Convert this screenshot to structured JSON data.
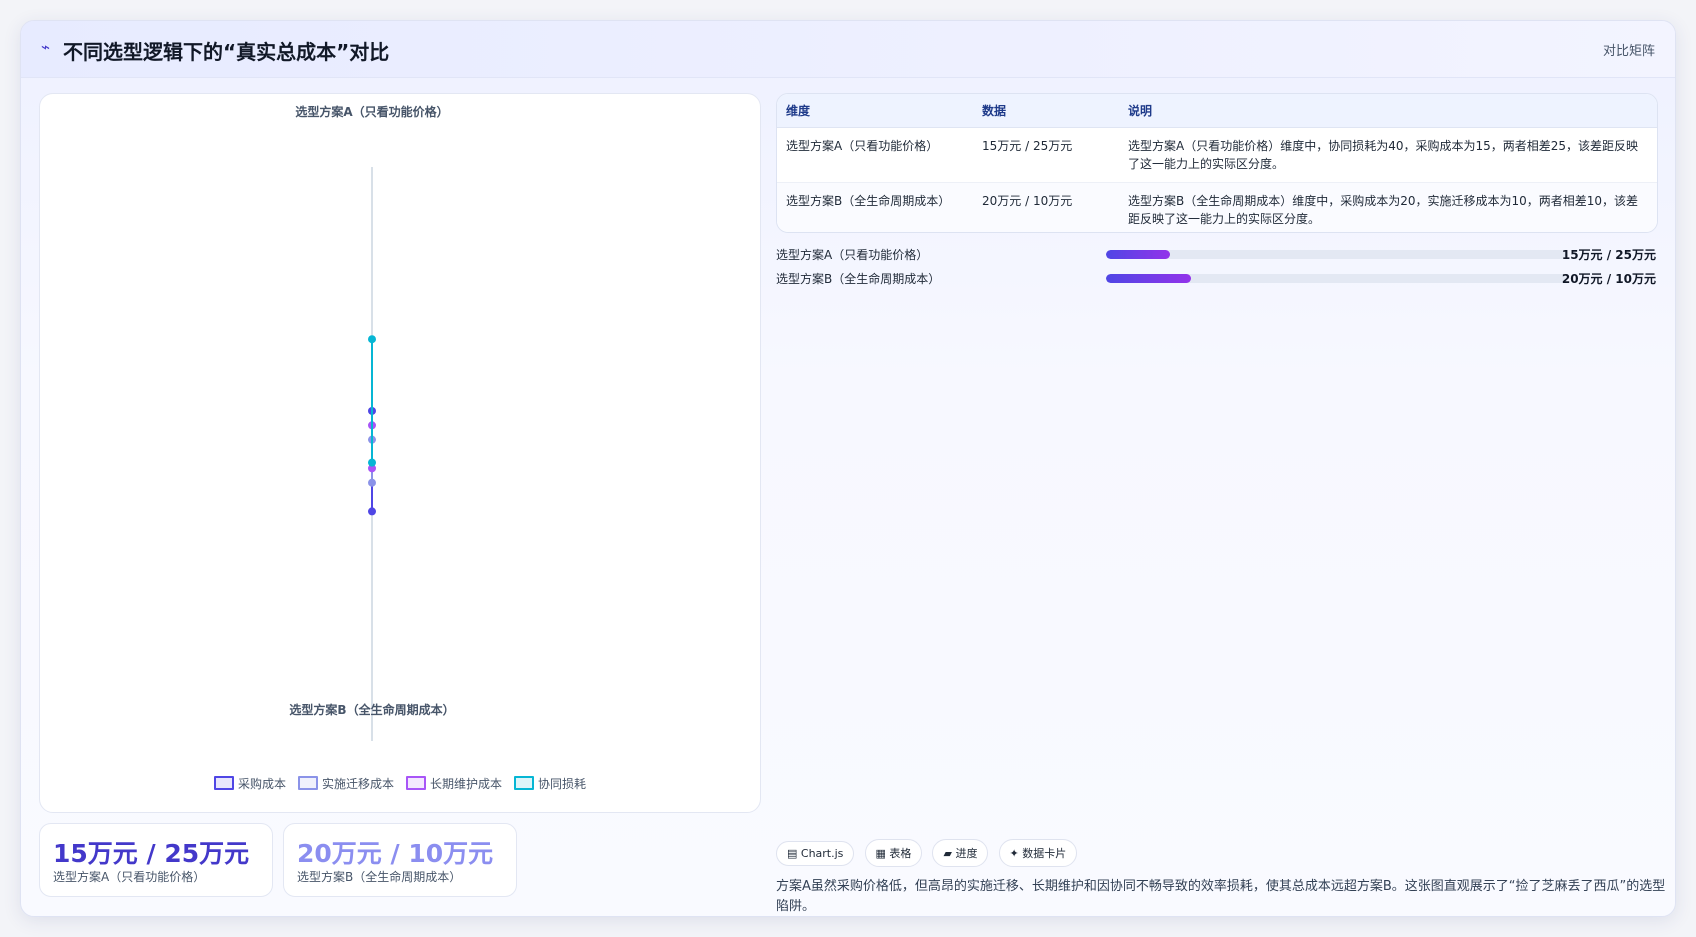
{
  "header": {
    "icon": "sparkline-icon",
    "title": "不同选型逻辑下的“真实总成本”对比",
    "right_label": "对比矩阵"
  },
  "chart_data": {
    "type": "radar",
    "categories": [
      "选型方案A（只看功能价格）",
      "选型方案B（全生命周期成本）"
    ],
    "series": [
      {
        "name": "采购成本",
        "values": [
          15,
          20
        ],
        "color": "#4f46e5"
      },
      {
        "name": "实施迁移成本",
        "values": [
          5,
          10
        ],
        "color": "#8b93e8"
      },
      {
        "name": "长期维护成本",
        "values": [
          10,
          5
        ],
        "color": "#a855f7"
      },
      {
        "name": "协同损耗",
        "values": [
          40,
          3
        ],
        "color": "#06b6d4"
      }
    ],
    "rmax": 100,
    "legend_position": "bottom"
  },
  "kpis": [
    {
      "value": "15万元 / 25万元",
      "label": "选型方案A（只看功能价格）",
      "color": "#4338ca"
    },
    {
      "value": "20万元 / 10万元",
      "label": "选型方案B（全生命周期成本）",
      "color": "#8b8ef0"
    }
  ],
  "table": {
    "headers": [
      "维度",
      "数据",
      "说明"
    ],
    "rows": [
      [
        "选型方案A（只看功能价格）",
        "15万元 / 25万元",
        "选型方案A（只看功能价格）维度中，协同损耗为40，采购成本为15，两者相差25，该差距反映了这一能力上的实际区分度。"
      ],
      [
        "选型方案B（全生命周期成本）",
        "20万元 / 10万元",
        "选型方案B（全生命周期成本）维度中，采购成本为20，实施迁移成本为10，两者相差10，该差距反映了这一能力上的实际区分度。"
      ]
    ]
  },
  "bars": [
    {
      "label": "选型方案A（只看功能价格）",
      "value": "15万元 / 25万元",
      "progress": 0.14
    },
    {
      "label": "选型方案B（全生命周期成本）",
      "value": "20万元 / 10万元",
      "progress": 0.185
    }
  ],
  "chips": [
    "▤ Chart.js",
    "▦ 表格",
    "▰ 进度",
    "✦ 数据卡片"
  ],
  "summary": "方案A虽然采购价格低，但高昂的实施迁移、长期维护和因协同不畅导致的效率损耗，使其总成本远超方案B。这张图直观展示了“捡了芝麻丢了西瓜”的选型陷阱。"
}
